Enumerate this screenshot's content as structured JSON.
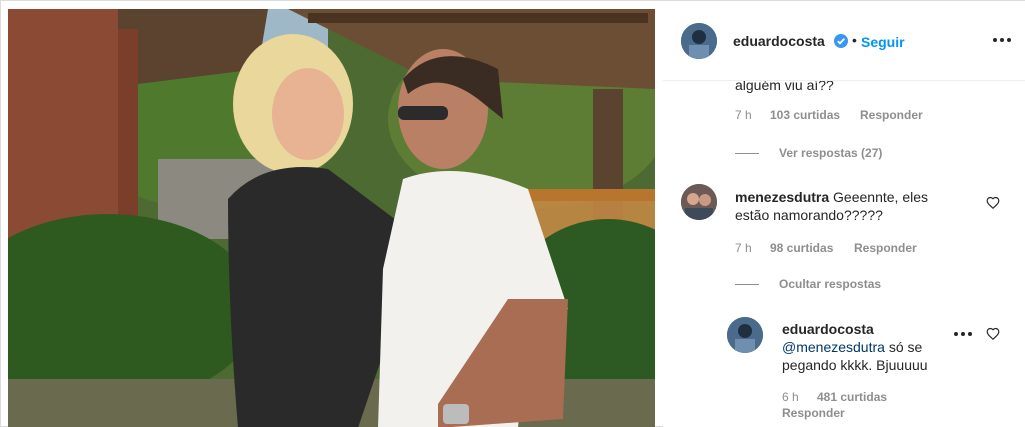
{
  "header": {
    "username": "eduardocosta",
    "separator": "•",
    "follow_label": "Seguir",
    "more_icon": "more-options-icon",
    "verified_color": "#3897f0"
  },
  "comments": {
    "top_partial": {
      "text": "alguém viu aí??",
      "time": "7 h",
      "likes": "103 curtidas",
      "reply": "Responder",
      "view_replies": "Ver respostas (27)"
    },
    "main": {
      "username": "menezesdutra",
      "text_line1": "Geeennte, eles",
      "text_line2": "estão namorando?????",
      "time": "7 h",
      "likes": "98 curtidas",
      "reply": "Responder",
      "hide_replies": "Ocultar respostas"
    },
    "reply": {
      "username": "eduardocosta",
      "mention": "@menezesdutra",
      "text_line1": " só se",
      "text_line2": "pegando kkkk. Bjuuuuu",
      "time": "6 h",
      "likes": "481 curtidas",
      "reply": "Responder"
    }
  },
  "colors": {
    "link_blue": "#0095f6",
    "meta_gray": "#8e8e8e",
    "text": "#262626"
  }
}
